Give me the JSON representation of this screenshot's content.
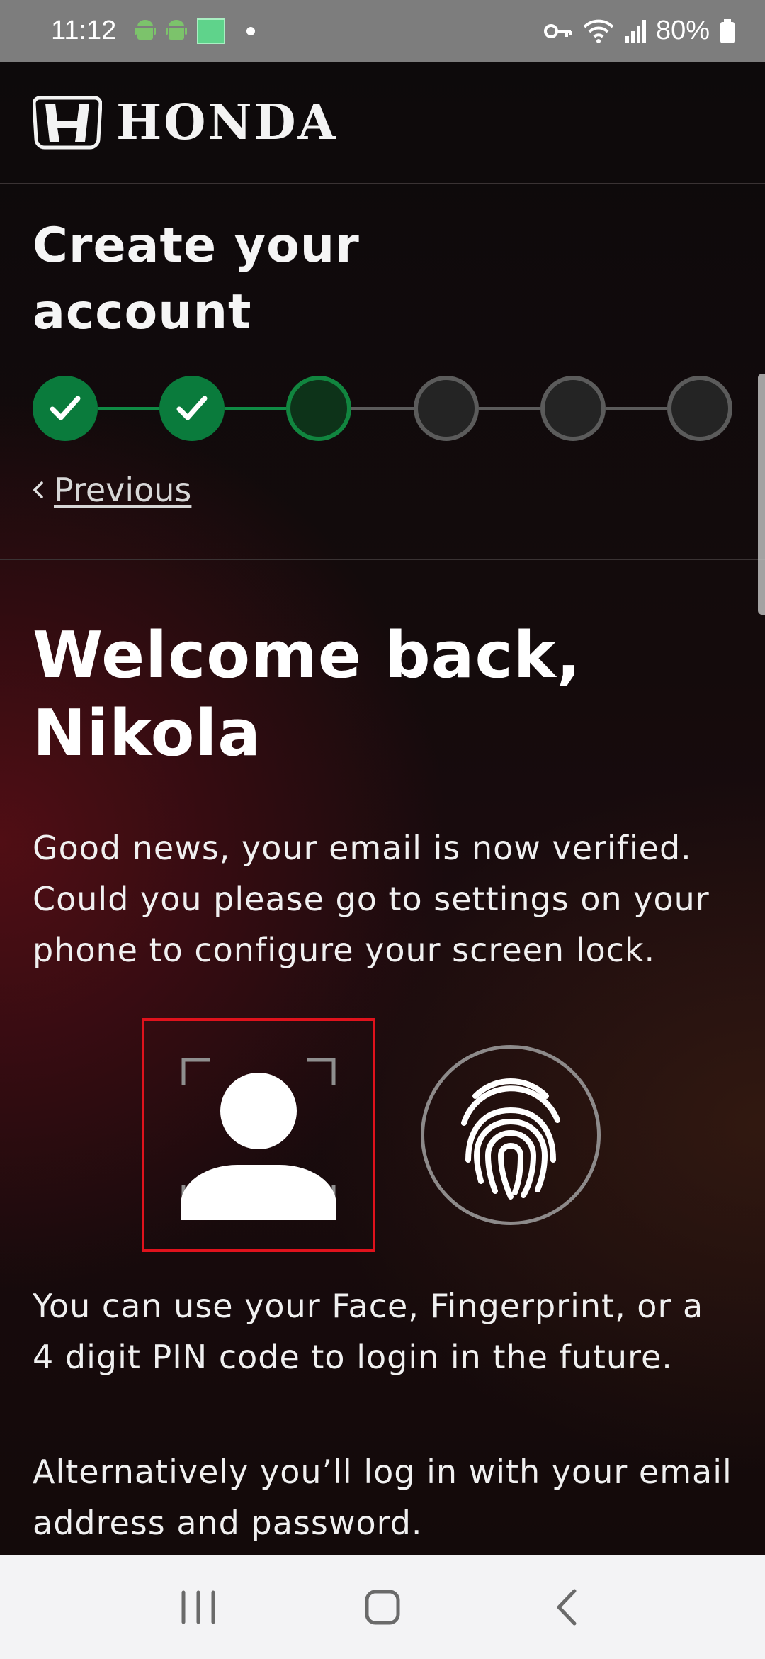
{
  "status_bar": {
    "time": "11:12",
    "battery": "80%",
    "icons": [
      "android-icon",
      "android-icon",
      "app-grid-icon",
      "dot-icon",
      "key-icon",
      "wifi-icon",
      "signal-icon",
      "battery-icon"
    ]
  },
  "header": {
    "brand": "HONDA",
    "logo_icon": "honda-h-logo"
  },
  "steps": {
    "title": "Create your account",
    "states": [
      "done",
      "done",
      "current",
      "todo",
      "todo",
      "todo"
    ],
    "colors": {
      "done": "#0a7b3c",
      "current": "#11853f",
      "todo": "#5b5b5b"
    },
    "previous_label": "Previous"
  },
  "main": {
    "welcome_title": "Welcome back, Nikola",
    "intro": "Good news, your email is now verified. Could you please go to settings on your phone to configure your screen lock.",
    "biometric_icons": [
      "face-id-icon",
      "fingerprint-icon"
    ],
    "highlight_color": "#e0121c",
    "info": "You can use your Face, Fingerprint, or a 4 digit PIN code to login in the future.",
    "alternative": "Alternatively you’ll log in with your email address and password."
  },
  "nav_bar": {
    "buttons": [
      "recents-icon",
      "home-icon",
      "back-icon"
    ]
  }
}
